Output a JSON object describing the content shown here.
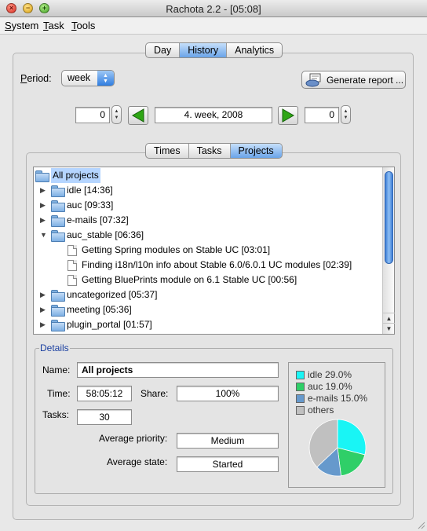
{
  "window": {
    "title": "Rachota 2.2 - [05:08]"
  },
  "menu": [
    {
      "label": "System",
      "mnemonic": "S",
      "rest": "ystem"
    },
    {
      "label": "Task",
      "mnemonic": "T",
      "rest": "ask"
    },
    {
      "label": "Tools",
      "mnemonic": "T",
      "rest": "ools"
    }
  ],
  "main_tabs": [
    "Day",
    "History",
    "Analytics"
  ],
  "main_tab_selected": "History",
  "period": {
    "label_mnemonic": "P",
    "label_rest": "eriod:",
    "value": "week"
  },
  "generate_report": "Generate report ...",
  "navigator": {
    "left_value": "0",
    "week_label": "4. week, 2008",
    "right_value": "0"
  },
  "sub_tabs": [
    "Times",
    "Tasks",
    "Projects"
  ],
  "sub_tab_selected": "Projects",
  "tree": {
    "root": "All projects",
    "nodes": [
      {
        "label": "idle [14:36]",
        "expanded": false
      },
      {
        "label": "auc [09:33]",
        "expanded": false
      },
      {
        "label": "e-mails [07:32]",
        "expanded": false
      },
      {
        "label": "auc_stable [06:36]",
        "expanded": true
      },
      {
        "label": "Getting Spring modules on Stable UC [03:01]",
        "leaf": true
      },
      {
        "label": "Finding i18n/l10n info about Stable 6.0/6.0.1 UC modules [02:39]",
        "leaf": true
      },
      {
        "label": "Getting BluePrints module on 6.1 Stable UC [00:56]",
        "leaf": true
      },
      {
        "label": "uncategorized [05:37]",
        "expanded": false
      },
      {
        "label": "meeting [05:36]",
        "expanded": false
      },
      {
        "label": "plugin_portal [01:57]",
        "expanded": false
      }
    ]
  },
  "details": {
    "legend": "Details",
    "name_label": "Name:",
    "name_value": "All projects",
    "time_label": "Time:",
    "time_value": "58:05:12",
    "share_label": "Share:",
    "share_value": "100%",
    "tasks_label": "Tasks:",
    "tasks_value": "30",
    "avg_priority_label": "Average priority:",
    "avg_priority_value": "Medium",
    "avg_state_label": "Average state:",
    "avg_state_value": "Started"
  },
  "chart_data": {
    "type": "pie",
    "series": [
      {
        "name": "idle 29.0%",
        "value": 29.0,
        "color": "#19f5f5"
      },
      {
        "name": "auc 19.0%",
        "value": 19.0,
        "color": "#2fcf68"
      },
      {
        "name": "e-mails 15.0%",
        "value": 15.0,
        "color": "#6699cc"
      },
      {
        "name": "others",
        "value": 37.0,
        "color": "#c0c0c0"
      }
    ]
  }
}
